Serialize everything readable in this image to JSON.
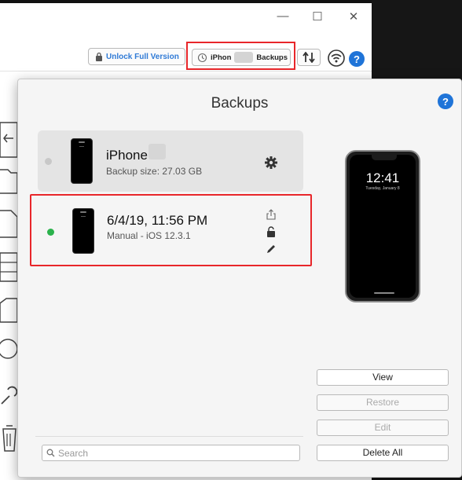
{
  "window": {
    "controls": {
      "minimize": "—",
      "maximize": "☐",
      "close": "✕"
    }
  },
  "toolbar": {
    "unlock_label": "Unlock Full Version",
    "device_label_prefix": "iPhon",
    "device_label_suffix": "Backups",
    "help_label": "?"
  },
  "popup": {
    "title": "Backups",
    "help_label": "?",
    "backups": [
      {
        "title": "iPhone",
        "subtitle": "Backup size: 27.03 GB",
        "status_color": "#c8c8c8"
      },
      {
        "title": "6/4/19, 11:56 PM",
        "subtitle": "Manual - iOS 12.3.1",
        "status_color": "#2bb24c"
      }
    ],
    "phone": {
      "time": "12:41",
      "date": "Tuesday, January 8"
    },
    "buttons": {
      "view": "View",
      "restore": "Restore",
      "edit": "Edit",
      "delete_all": "Delete All"
    },
    "search": {
      "placeholder": "Search",
      "value": ""
    }
  },
  "colors": {
    "accent": "#1f74d8",
    "highlight_box": "#e8262a"
  }
}
